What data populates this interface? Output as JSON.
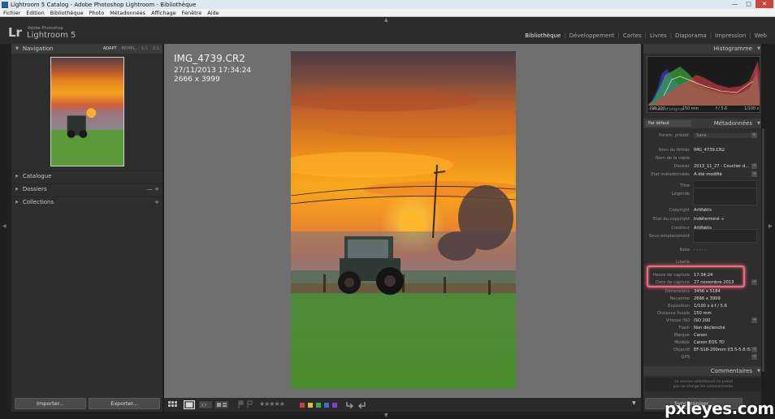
{
  "window": {
    "title": "Lightroom 5 Catalog - Adobe Photoshop Lightroom - Bibliothèque",
    "buttons": {
      "minimize": "—",
      "maximize": "□",
      "close": "✕"
    }
  },
  "menubar": [
    "Fichier",
    "Edition",
    "Bibliothèque",
    "Photo",
    "Métadonnées",
    "Affichage",
    "Fenêtre",
    "Aide"
  ],
  "identity": {
    "logo": "Lr",
    "vendor": "Adobe Photoshop",
    "product": "Lightroom 5"
  },
  "modules": {
    "items": [
      "Bibliothèque",
      "Développement",
      "Cartes",
      "Livres",
      "Diaporama",
      "Impression",
      "Web"
    ],
    "active": "Bibliothèque"
  },
  "left_panel": {
    "navigator": {
      "title": "Navigation",
      "options": [
        "ADAPT",
        "REMPL.",
        "1:1",
        "2:1"
      ]
    },
    "sections": [
      {
        "label": "Catalogue",
        "action": ""
      },
      {
        "label": "Dossiers",
        "action": "— +"
      },
      {
        "label": "Collections",
        "action": "+"
      }
    ],
    "buttons": {
      "import": "Importer...",
      "export": "Exporter..."
    }
  },
  "loupe_overlay": {
    "filename": "IMG_4739.CR2",
    "datetime": "27/11/2013 17:34:24",
    "dimensions": "2666 x 3999"
  },
  "toolbar": {
    "icons": [
      "grid-view-icon",
      "loupe-view-icon",
      "compare-view-icon",
      "survey-view-icon",
      "flag-icon",
      "reject-flag-icon",
      "rotate-left-icon",
      "rotate-right-icon",
      "dropdown-icon"
    ],
    "rating": "★★★★★",
    "color_labels": [
      "#d33a3a",
      "#d9c22c",
      "#3ab03a",
      "#3a6fd3",
      "#8a3ad3"
    ]
  },
  "right_panel": {
    "histogram": {
      "title": "Histogramme",
      "info": [
        "ISO 200",
        "150 mm",
        "f / 5.6",
        "1/100 s"
      ],
      "original": "Photo d'origine"
    },
    "metadata": {
      "title": "Métadonnées",
      "preset_label": "Par défaut",
      "preset_row": {
        "label": "Param. prédéf.",
        "value": "Sans"
      },
      "fields": [
        {
          "label": "Nom du fichier",
          "value": "IMG_4739.CR2"
        },
        {
          "label": "Nom de la copie",
          "value": ""
        },
        {
          "label": "Dossier",
          "value": "2013_11_27 - Coucher d..."
        },
        {
          "label": "État métadonnées",
          "value": "A été modifié"
        },
        {
          "label": "Titre",
          "value": ""
        },
        {
          "label": "Légende",
          "value": ""
        },
        {
          "label": "Copyright",
          "value": "Artifakts"
        },
        {
          "label": "État du copyright",
          "value": "Indéterminé ÷"
        },
        {
          "label": "Créateur",
          "value": "Artifakts"
        },
        {
          "label": "Sous-emplacement",
          "value": ""
        },
        {
          "label": "Note",
          "value": "· · · · ·"
        },
        {
          "label": "Libellé",
          "value": ""
        },
        {
          "label": "Heure de capture",
          "value": "17:34:24"
        },
        {
          "label": "Date de capture",
          "value": "27 novembre 2013"
        },
        {
          "label": "Dimensions",
          "value": "3456 x 5184"
        },
        {
          "label": "Recadrée",
          "value": "2666 x 3999"
        },
        {
          "label": "Exposition",
          "value": "1/100 s à f / 5.6"
        },
        {
          "label": "Distance focale",
          "value": "150 mm"
        },
        {
          "label": "Vitesse ISO",
          "value": "ISO 200"
        },
        {
          "label": "Flash",
          "value": "Non déclenché"
        },
        {
          "label": "Marque",
          "value": "Canon"
        },
        {
          "label": "Modèle",
          "value": "Canon EOS 7D"
        },
        {
          "label": "Objectif",
          "value": "EF-S18-200mm f/3.5-5.6 IS"
        },
        {
          "label": "GPS",
          "value": ""
        }
      ]
    },
    "comments": {
      "title": "Commentaires",
      "note_line1": "Le service sélectionné ne prend",
      "note_line2": "pas en charge les commentaires."
    },
    "sync_button": "Synchroniser..."
  },
  "watermark": "pxleyes.com"
}
